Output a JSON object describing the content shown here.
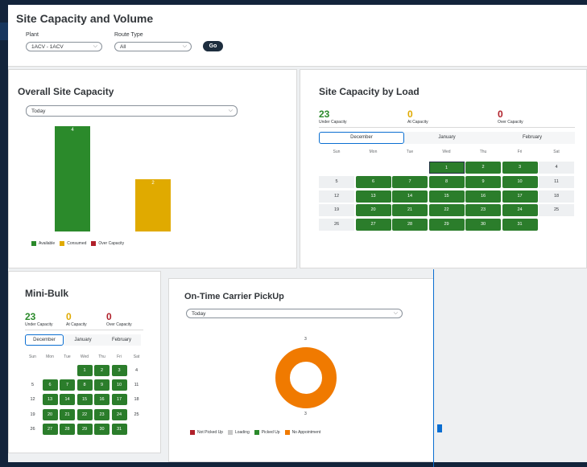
{
  "header": {
    "title": "Site Capacity and Volume",
    "plant_label": "Plant",
    "plant_value": "1ACV - 1ACV",
    "route_label": "Route Type",
    "route_value": "All",
    "go_label": "Go"
  },
  "overall": {
    "title": "Overall Site Capacity",
    "filter": "Today",
    "chart_data": {
      "type": "bar",
      "categories": [
        "Available",
        "Consumed"
      ],
      "values": [
        4,
        2
      ],
      "colors": [
        "#2b8a2b",
        "#e0aa00"
      ],
      "legend": [
        {
          "label": "Available",
          "color": "#2b8a2b"
        },
        {
          "label": "Consumed",
          "color": "#e0aa00"
        },
        {
          "label": "Over Capacity",
          "color": "#b0202a"
        }
      ]
    }
  },
  "by_load": {
    "title": "Site Capacity by Load",
    "stats": [
      {
        "value": "23",
        "label": "Under Capacity",
        "color": "#2b8a2b"
      },
      {
        "value": "0",
        "label": "At Capacity",
        "color": "#e0aa00"
      },
      {
        "value": "0",
        "label": "Over Capacity",
        "color": "#b0202a"
      }
    ],
    "tabs": [
      "December",
      "January",
      "February"
    ],
    "active_tab": 0,
    "weekdays": [
      "Sun",
      "Mon",
      "Tue",
      "Wed",
      "Thu",
      "Fri",
      "Sat"
    ],
    "weeks": [
      [
        null,
        null,
        null,
        "1",
        "2",
        "3",
        "4"
      ],
      [
        "5",
        "6",
        "7",
        "8",
        "9",
        "10",
        "11"
      ],
      [
        "12",
        "13",
        "14",
        "15",
        "16",
        "17",
        "18"
      ],
      [
        "19",
        "20",
        "21",
        "22",
        "23",
        "24",
        "25"
      ],
      [
        "26",
        "27",
        "28",
        "29",
        "30",
        "31",
        null
      ]
    ]
  },
  "mini_bulk": {
    "title": "Mini-Bulk",
    "stats": [
      {
        "value": "23",
        "label": "Under Capacity",
        "color": "#2b8a2b"
      },
      {
        "value": "0",
        "label": "At Capacity",
        "color": "#e0aa00"
      },
      {
        "value": "0",
        "label": "Over Capacity",
        "color": "#b0202a"
      }
    ],
    "tabs": [
      "December",
      "January",
      "February"
    ],
    "active_tab": 0,
    "weekdays": [
      "Sun",
      "Mon",
      "Tue",
      "Wed",
      "Thu",
      "Fri",
      "Sat"
    ],
    "weeks": [
      [
        null,
        null,
        null,
        "1",
        "2",
        "3",
        "4"
      ],
      [
        "5",
        "6",
        "7",
        "8",
        "9",
        "10",
        "11"
      ],
      [
        "12",
        "13",
        "14",
        "15",
        "16",
        "17",
        "18"
      ],
      [
        "19",
        "20",
        "21",
        "22",
        "23",
        "24",
        "25"
      ],
      [
        "26",
        "27",
        "28",
        "29",
        "30",
        "31",
        null
      ]
    ]
  },
  "pickup": {
    "title": "On-Time Carrier PickUp",
    "filter": "Today",
    "chart_data": {
      "type": "pie",
      "categories": [
        "Not Picked Up",
        "Loading",
        "Picked Up",
        "No Appointment"
      ],
      "values": [
        0,
        0,
        0,
        3
      ],
      "top_label": "3",
      "bottom_label": "3",
      "legend": [
        {
          "label": "Not Picked Up",
          "color": "#b0202a"
        },
        {
          "label": "Loading",
          "color": "#c8c8c8"
        },
        {
          "label": "Picked Up",
          "color": "#2b8a2b"
        },
        {
          "label": "No Appointment",
          "color": "#f07a00"
        }
      ]
    }
  }
}
